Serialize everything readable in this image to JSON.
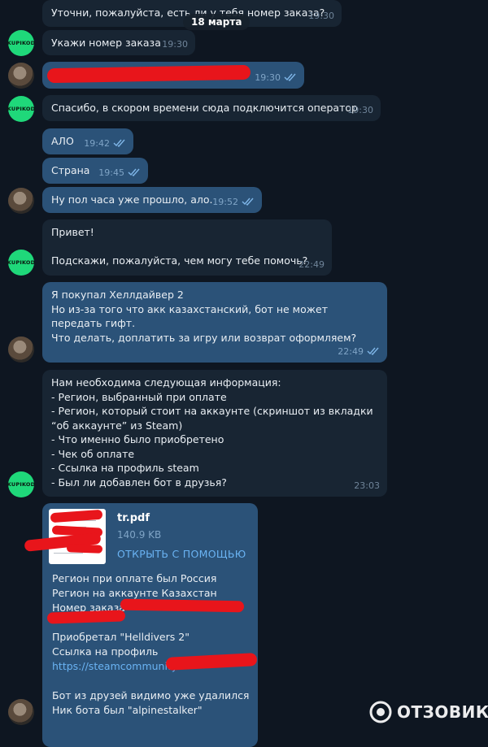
{
  "date_separator": "18 марта",
  "bot_avatar_text": "KUPIKOD",
  "messages": [
    {
      "text": "Уточни, пожалуйста, есть ли у тебя номер заказа?",
      "time": "19:30"
    },
    {
      "text": "Укажи номер заказа",
      "time": "19:30"
    },
    {
      "text": "",
      "time": "19:30",
      "status": "read"
    },
    {
      "text": "Спасибо, в скором времени сюда подключится оператор",
      "time": "19:30"
    },
    {
      "text": "АЛО",
      "time": "19:42",
      "status": "read"
    },
    {
      "text": "Страна",
      "time": "19:45",
      "status": "read"
    },
    {
      "text": "Ну пол часа уже прошло, ало.",
      "time": "19:52",
      "status": "read"
    },
    {
      "text": "Привет!\n\nПодскажи, пожалуйста, чем могу тебе помочь?",
      "time": "22:49"
    },
    {
      "text": "Я покупал Хеллдайвер 2\nНо из-за того что акк казахстанский, бот не может передать гифт.\nЧто делать, доплатить за игру или возврат оформляем?",
      "time": "22:49",
      "status": "read"
    },
    {
      "text": "Нам необходима следующая информация:\n- Регион, выбранный при оплате\n- Регион, который стоит на аккаунте (скриншот из вкладки “об аккаунте” из Steam)\n- Что именно было приобретено\n- Чек об оплате\n- Ссылка на профиль steam\n- Был ли добавлен бот в друзья?",
      "time": "23:03"
    }
  ],
  "attachment": {
    "file_name": "tr.pdf",
    "file_size": "140.9 KB",
    "open_with": "ОТКРЫТЬ С ПОМОЩЬЮ"
  },
  "last_message": {
    "line1": "Регион при оплате был Россия",
    "line2": "Регион на аккаунте Казахстан",
    "line3": "Номер заказа",
    "line4": "Приобретал \"Helldivers 2\"",
    "line5": "Ссылка на профиль",
    "link": "https://steamcommunity",
    "line6": "Бот из друзей видимо уже удалился",
    "line7": "Ник бота был \"alpinestalker\""
  },
  "watermark": "ОТЗОВИК",
  "colors": {
    "background": "#0e1621",
    "incoming_bubble": "#182533",
    "outgoing_bubble": "#2b5278",
    "bot_avatar": "#1fd87a",
    "link": "#6ab3f3",
    "redaction": "#e8151b"
  }
}
